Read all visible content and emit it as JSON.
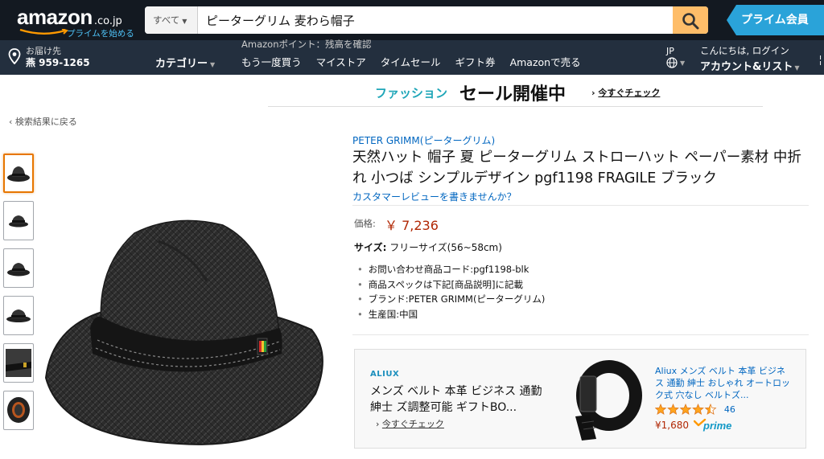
{
  "header": {
    "logo_text": "amazon",
    "logo_tld": ".co.jp",
    "logo_prime": "プライムを始める",
    "search_category": "すべて",
    "search_query": "ピーターグリム 麦わら帽子",
    "prime_banner": "プライム会員",
    "deliver_line1": "お届け先",
    "deliver_line2": "燕 959-1265",
    "category_menu": "カテゴリー",
    "points_text": "Amazonポイント：残高を確認",
    "nav_links": [
      "もう一度買う",
      "マイストア",
      "タイムセール",
      "ギフト券",
      "Amazonで売る"
    ],
    "lang": "JP",
    "account_line1": "こんにちは, ログイン",
    "account_line2": "アカウント&リスト"
  },
  "promo": {
    "fashion": "ファッション",
    "sale": "セール開催中",
    "check": "今すぐチェック"
  },
  "back_link": "検索結果に戻る",
  "product": {
    "brand": "PETER GRIMM(ピーターグリム)",
    "title": "天然ハット 帽子 夏 ピーターグリム ストローハット ペーパー素材 中折れ 小つば シンプルデザイン pgf1198 FRAGILE ブラック",
    "review_link": "カスタマーレビューを書きませんか？",
    "price_label": "価格:",
    "price": "￥ 7,236",
    "size_label": "サイズ:",
    "size_value": "フリーサイズ(56~58cm)",
    "bullets": [
      "お問い合わせ商品コード:pgf1198-blk",
      "商品スペックは下記[商品説明]に記載",
      "ブランド:PETER GRIMM(ピーターグリム)",
      "生産国:中国"
    ]
  },
  "ad": {
    "brand": "ALIUX",
    "title": "メンズ ベルト 本革 ビジネス 通勤 紳士 ズ調整可能 ギフトBO...",
    "check": "今すぐチェック",
    "product_title": "Aliux メンズ ベルト 本革 ビジネス 通勤 紳士 おしゃれ オートロック式 穴なし ベルトズ...",
    "rating_count": "46",
    "rating": 4.5,
    "price": "¥1,680",
    "prime": "prime"
  },
  "colors": {
    "nav_dark": "#131921",
    "nav_light": "#232f3e",
    "search_button": "#febd69",
    "prime_blue": "#2aa3d9",
    "link": "#0066c0",
    "price": "#b12704",
    "thumb_selected": "#e77600"
  }
}
